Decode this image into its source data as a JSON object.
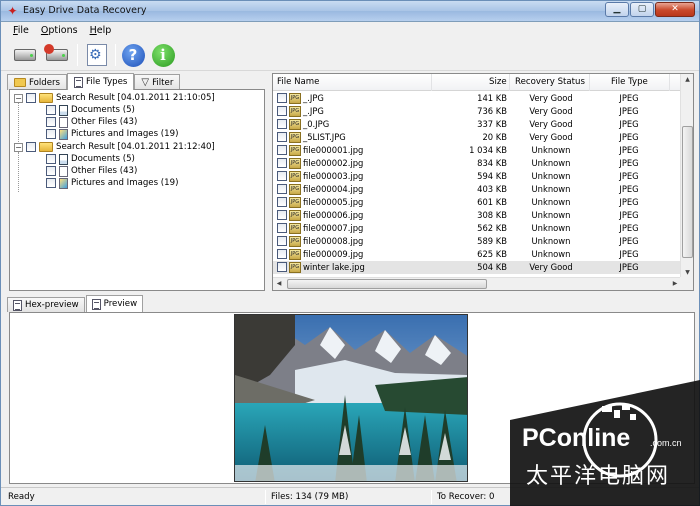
{
  "window": {
    "title": "Easy Drive Data Recovery",
    "app_icon": "recovery-app-icon"
  },
  "menu": [
    {
      "key": "F",
      "rest": "ile"
    },
    {
      "key": "O",
      "rest": "ptions"
    },
    {
      "key": "H",
      "rest": "elp"
    }
  ],
  "toolbar": {
    "buttons": [
      "scan-drive-icon",
      "recover-drive-icon",
      "settings-icon",
      "help-icon",
      "about-info-icon"
    ],
    "help_glyph": "?",
    "info_glyph": "i"
  },
  "left_tabs": [
    {
      "label": "Folders",
      "active": false
    },
    {
      "label": "File Types",
      "active": true
    },
    {
      "label": "Filter",
      "active": false
    }
  ],
  "tree": [
    {
      "label": "Search Result [04.01.2011 21:10:05]",
      "level": 0,
      "icon": "folder",
      "expander": "−"
    },
    {
      "label": "Documents (5)",
      "level": 1,
      "icon": "doc"
    },
    {
      "label": "Other Files (43)",
      "level": 1,
      "icon": "file"
    },
    {
      "label": "Pictures and Images (19)",
      "level": 1,
      "icon": "pic"
    },
    {
      "label": "Search Result [04.01.2011 21:12:40]",
      "level": 0,
      "icon": "folder",
      "expander": "−"
    },
    {
      "label": "Documents (5)",
      "level": 1,
      "icon": "doc"
    },
    {
      "label": "Other Files (43)",
      "level": 1,
      "icon": "file"
    },
    {
      "label": "Pictures and Images (19)",
      "level": 1,
      "icon": "pic"
    }
  ],
  "file_list": {
    "columns": [
      "File Name",
      "Size",
      "Recovery Status",
      "File Type"
    ],
    "rows": [
      {
        "name": "_.JPG",
        "size": "141 KB",
        "status": "Very Good",
        "type": "JPEG"
      },
      {
        "name": "_.JPG",
        "size": "736 KB",
        "status": "Very Good",
        "type": "JPEG"
      },
      {
        "name": "_0.JPG",
        "size": "337 KB",
        "status": "Very Good",
        "type": "JPEG"
      },
      {
        "name": "_5LIST.JPG",
        "size": "20 KB",
        "status": "Very Good",
        "type": "JPEG"
      },
      {
        "name": "file000001.jpg",
        "size": "1 034 KB",
        "status": "Unknown",
        "type": "JPEG"
      },
      {
        "name": "file000002.jpg",
        "size": "834 KB",
        "status": "Unknown",
        "type": "JPEG"
      },
      {
        "name": "file000003.jpg",
        "size": "594 KB",
        "status": "Unknown",
        "type": "JPEG"
      },
      {
        "name": "file000004.jpg",
        "size": "403 KB",
        "status": "Unknown",
        "type": "JPEG"
      },
      {
        "name": "file000005.jpg",
        "size": "601 KB",
        "status": "Unknown",
        "type": "JPEG"
      },
      {
        "name": "file000006.jpg",
        "size": "308 KB",
        "status": "Unknown",
        "type": "JPEG"
      },
      {
        "name": "file000007.jpg",
        "size": "562 KB",
        "status": "Unknown",
        "type": "JPEG"
      },
      {
        "name": "file000008.jpg",
        "size": "589 KB",
        "status": "Unknown",
        "type": "JPEG"
      },
      {
        "name": "file000009.jpg",
        "size": "625 KB",
        "status": "Unknown",
        "type": "JPEG"
      },
      {
        "name": "winter lake.jpg",
        "size": "504 KB",
        "status": "Very Good",
        "type": "JPEG",
        "selected": true
      }
    ],
    "jpg_icon_text": "JPG"
  },
  "bottom_tabs": [
    {
      "label": "Hex-preview",
      "active": false
    },
    {
      "label": "Preview",
      "active": true
    }
  ],
  "status": {
    "left": "Ready",
    "files": "Files: 134 (79 MB)",
    "recover": "To Recover: 0"
  },
  "watermark": {
    "brand": "PConline",
    "domain": ".com.cn",
    "cn": "太平洋电脑网"
  }
}
